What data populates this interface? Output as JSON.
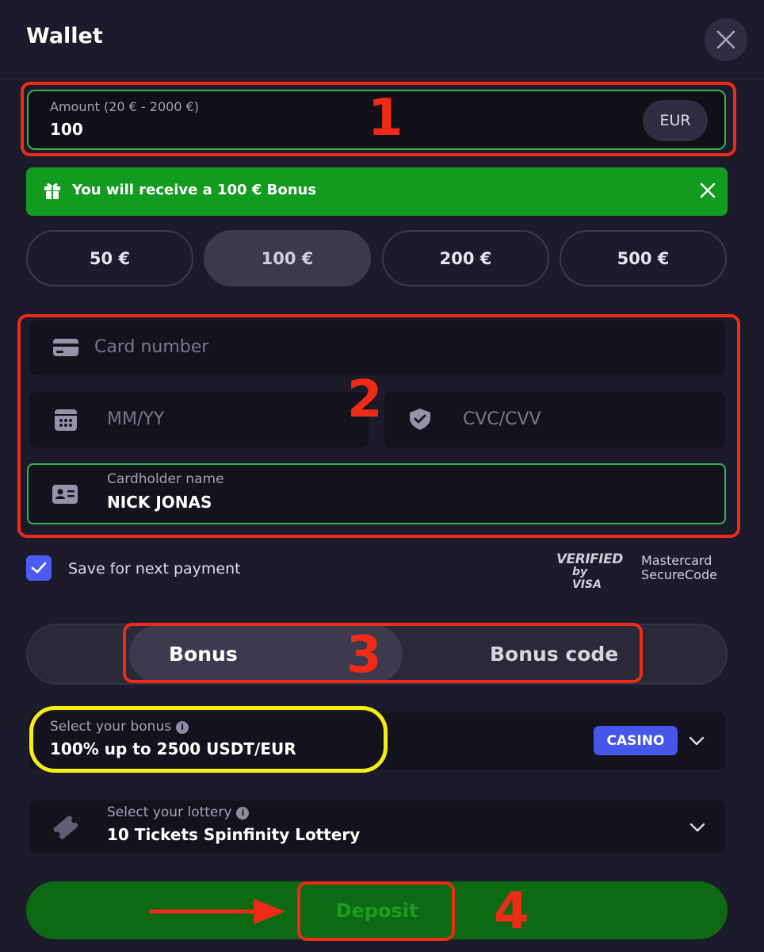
{
  "header": {
    "title": "Wallet"
  },
  "amount": {
    "label": "Amount (20 € - 2000 €)",
    "value": "100",
    "currency": "EUR"
  },
  "bonus_banner": {
    "text": "You will receive a 100 € Bonus"
  },
  "presets": [
    {
      "label": "50 €",
      "selected": false
    },
    {
      "label": "100 €",
      "selected": true
    },
    {
      "label": "200 €",
      "selected": false
    },
    {
      "label": "500 €",
      "selected": false
    }
  ],
  "card": {
    "number_placeholder": "Card number",
    "expiry_placeholder": "MM/YY",
    "cvc_placeholder": "CVC/CVV",
    "holder_label": "Cardholder name",
    "holder_value": "NICK JONAS"
  },
  "save": {
    "label": "Save for next payment",
    "checked": true
  },
  "security_logos": {
    "visa_top": "VERIFIED",
    "visa_bottom": "by VISA",
    "mastercard_line1": "Mastercard",
    "mastercard_line2": "SecureCode"
  },
  "bonus_tabs": {
    "bonus": "Bonus",
    "bonus_code": "Bonus code",
    "active": "bonus"
  },
  "bonus_select": {
    "label": "Select your bonus",
    "value": "100% up to 2500 USDT/EUR",
    "badge": "CASINO"
  },
  "lottery_select": {
    "label": "Select your lottery",
    "value": "10 Tickets Spinfinity Lottery"
  },
  "deposit": {
    "label": "Deposit"
  },
  "annotations": {
    "n1": "1",
    "n2": "2",
    "n3": "3",
    "n4": "4"
  },
  "colors": {
    "accent_green": "#37b34a",
    "banner_green": "#139b20",
    "badge_blue": "#4457e8",
    "annotation_red": "#ee2b17",
    "annotation_yellow": "#f5ef11"
  }
}
